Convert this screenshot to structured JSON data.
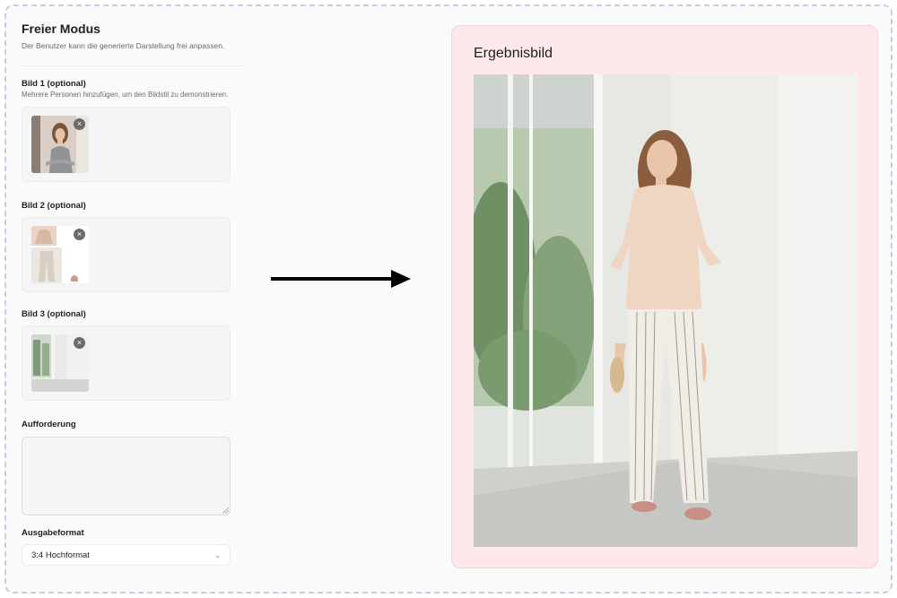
{
  "header": {
    "title": "Freier Modus",
    "subtitle": "Der Benutzer kann die generierte Darstellung frei anpassen."
  },
  "image1": {
    "label": "Bild 1 (optional)",
    "hint": "Mehrere Personen hinzufügen, um den Bildstil zu demonstrieren.",
    "remove": "×",
    "thumb_icon": "woman-portrait-image"
  },
  "image2": {
    "label": "Bild 2 (optional)",
    "remove": "×",
    "thumb_icon": "outfit-collage-image"
  },
  "image3": {
    "label": "Bild 3 (optional)",
    "remove": "×",
    "thumb_icon": "white-room-image"
  },
  "prompt": {
    "label": "Aufforderung",
    "value": "",
    "placeholder": ""
  },
  "output_format": {
    "label": "Ausgabeformat",
    "selected": "3:4 Hochformat",
    "chevron": "⌄"
  },
  "arrow_icon": "right-arrow-icon",
  "result": {
    "title": "Ergebnisbild",
    "image_icon": "generated-woman-in-white-room-image"
  },
  "colors": {
    "result_bg": "#fde8ec",
    "frame_border": "#c9cde8"
  }
}
